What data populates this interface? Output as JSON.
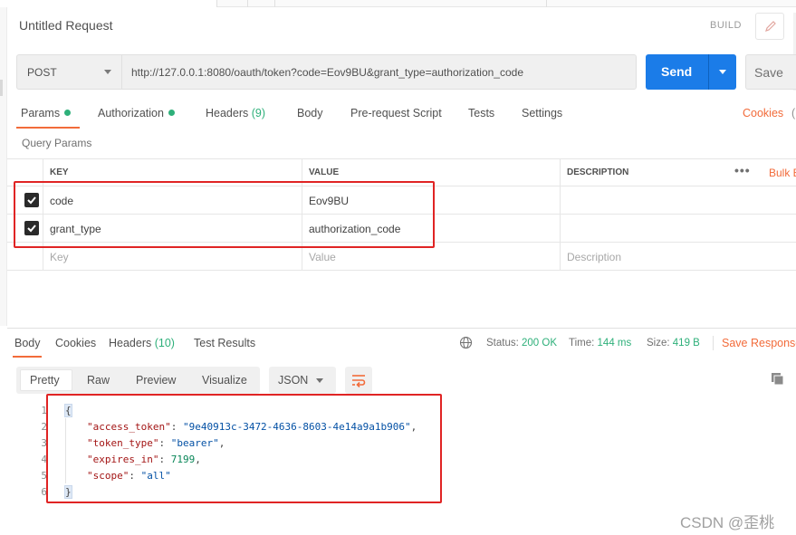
{
  "request": {
    "title": "Untitled Request",
    "build_label": "BUILD",
    "method": "POST",
    "url": "http://127.0.0.1:8080/oauth/token?code=Eov9BU&grant_type=authorization_code",
    "send_label": "Send",
    "save_label": "Save"
  },
  "request_tabs": {
    "params": "Params",
    "authorization": "Authorization",
    "headers": "Headers",
    "headers_count": "(9)",
    "body": "Body",
    "prerequest": "Pre-request Script",
    "tests": "Tests",
    "settings": "Settings",
    "cookies": "Cookies"
  },
  "query_params": {
    "title": "Query Params",
    "columns": {
      "key": "KEY",
      "value": "VALUE",
      "description": "DESCRIPTION"
    },
    "more": "•••",
    "bulk_edit": "Bulk E",
    "rows": [
      {
        "key": "code",
        "value": "Eov9BU",
        "checked": true
      },
      {
        "key": "grant_type",
        "value": "authorization_code",
        "checked": true
      }
    ],
    "placeholder": {
      "key": "Key",
      "value": "Value",
      "description": "Description"
    }
  },
  "response_tabs": {
    "body": "Body",
    "cookies": "Cookies",
    "headers": "Headers",
    "headers_count": "(10)",
    "test_results": "Test Results"
  },
  "response_status": {
    "status_label": "Status:",
    "status_value": "200 OK",
    "time_label": "Time:",
    "time_value": "144 ms",
    "size_label": "Size:",
    "size_value": "419 B",
    "save_response": "Save Response"
  },
  "view": {
    "pretty": "Pretty",
    "raw": "Raw",
    "preview": "Preview",
    "visualize": "Visualize",
    "format": "JSON"
  },
  "response_body": {
    "line_numbers": [
      "1",
      "2",
      "3",
      "4",
      "5",
      "6"
    ],
    "open_brace": "{",
    "close_brace": "}",
    "fields": [
      {
        "key": "\"access_token\"",
        "value": "\"9e40913c-3472-4636-8603-4e14a9a1b906\"",
        "type": "string",
        "trail": ","
      },
      {
        "key": "\"token_type\"",
        "value": "\"bearer\"",
        "type": "string",
        "trail": ","
      },
      {
        "key": "\"expires_in\"",
        "value": "7199",
        "type": "number",
        "trail": ","
      },
      {
        "key": "\"scope\"",
        "value": "\"all\"",
        "type": "string",
        "trail": ""
      }
    ]
  },
  "watermark": "CSDN @歪桃",
  "colors": {
    "accent_orange": "#f26b3a",
    "send_blue": "#1b7ce8",
    "status_green": "#2eb07a",
    "highlight_red": "#e02424"
  }
}
